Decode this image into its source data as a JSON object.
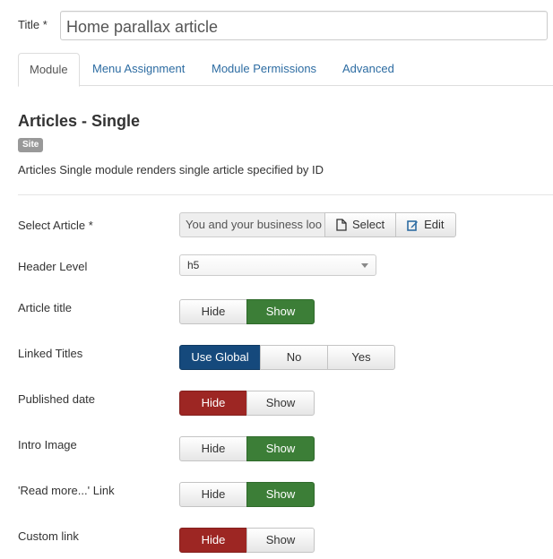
{
  "title_field": {
    "label": "Title *",
    "value": "Home parallax article"
  },
  "tabs": [
    {
      "label": "Module"
    },
    {
      "label": "Menu Assignment"
    },
    {
      "label": "Module Permissions"
    },
    {
      "label": "Advanced"
    }
  ],
  "module": {
    "heading": "Articles - Single",
    "badge": "Site",
    "description": "Articles Single module renders single article specified by ID"
  },
  "fields": {
    "select_article": {
      "label": "Select Article *",
      "value": "You and your business loo",
      "select_label": "Select",
      "edit_label": "Edit"
    },
    "header_level": {
      "label": "Header Level",
      "value": "h5"
    },
    "article_title": {
      "label": "Article title",
      "options": [
        "Hide",
        "Show"
      ],
      "selected": "Show"
    },
    "linked_titles": {
      "label": "Linked Titles",
      "options": [
        "Use Global",
        "No",
        "Yes"
      ],
      "selected": "Use Global"
    },
    "published_date": {
      "label": "Published date",
      "options": [
        "Hide",
        "Show"
      ],
      "selected": "Hide"
    },
    "intro_image": {
      "label": "Intro Image",
      "options": [
        "Hide",
        "Show"
      ],
      "selected": "Show"
    },
    "read_more_link": {
      "label": "'Read more...' Link",
      "options": [
        "Hide",
        "Show"
      ],
      "selected": "Show"
    },
    "custom_link": {
      "label": "Custom link",
      "options": [
        "Hide",
        "Show"
      ],
      "selected": "Hide"
    }
  },
  "colors": {
    "tab_link": "#2d6ca2",
    "show_active": "#3c7e37",
    "hide_active": "#9d2623",
    "global_active": "#15497c",
    "badge_bg": "#999999"
  },
  "icons": {
    "select_button": "file-icon",
    "edit_button": "edit-icon",
    "header_level_caret": "chevron-down-icon"
  }
}
